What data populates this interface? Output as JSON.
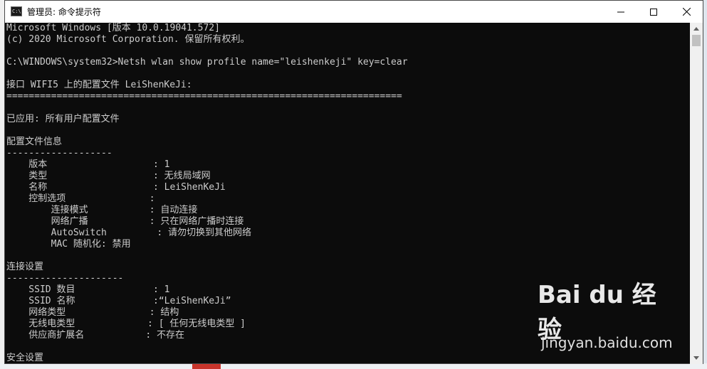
{
  "window": {
    "title": "管理员: 命令提示符",
    "icon_text": "C:\\"
  },
  "console": {
    "lines": [
      "Microsoft Windows [版本 10.0.19041.572]",
      "(c) 2020 Microsoft Corporation. 保留所有权利。",
      "",
      "C:\\WINDOWS\\system32>Netsh wlan show profile name=\"leishenkeji\" key=clear",
      "",
      "接口 WIFI5 上的配置文件 LeiShenKeJi:",
      "=======================================================================",
      "",
      "已应用: 所有用户配置文件",
      "",
      "配置文件信息",
      "-------------------",
      "    版本                   : 1",
      "    类型                   : 无线局域网",
      "    名称                   : LeiShenKeJi",
      "    控制选项               :",
      "        连接模式           : 自动连接",
      "        网络广播           : 只在网络广播时连接",
      "        AutoSwitch         : 请勿切换到其他网络",
      "        MAC 随机化: 禁用",
      "",
      "连接设置",
      "---------------------",
      "    SSID 数目              : 1",
      "    SSID 名称              :“LeiShenKeJi”",
      "    网络类型               : 结构",
      "    无线电类型             : [ 任何无线电类型 ]",
      "    供应商扩展名           : 不存在",
      "",
      "安全设置"
    ]
  },
  "watermark": {
    "logo_text": "Bai du 经验",
    "url": "jingyan.baidu.com"
  },
  "colors": {
    "console_bg": "#0c0c0c",
    "console_fg": "#cccccc",
    "titlebar_bg": "#ffffff"
  },
  "icons": [
    "cmd-app-icon",
    "minimize-icon",
    "maximize-icon",
    "close-icon",
    "scroll-up-icon",
    "scroll-down-icon",
    "baidu-paw-icon"
  ]
}
